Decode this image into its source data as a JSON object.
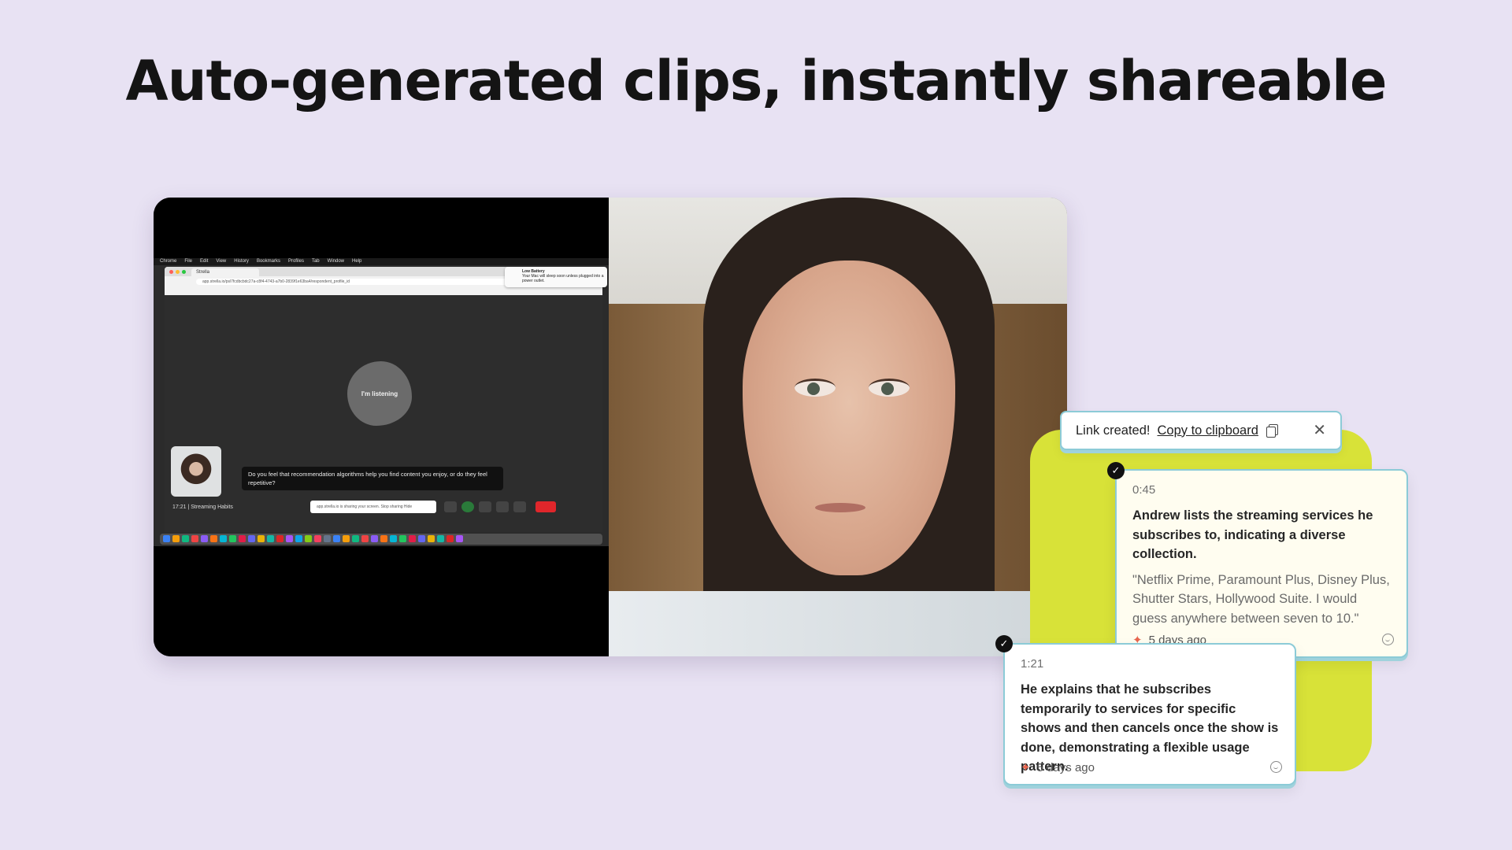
{
  "headline": "Auto-generated clips, instantly shareable",
  "mini_screen": {
    "menubar": [
      "Chrome",
      "File",
      "Edit",
      "View",
      "History",
      "Bookmarks",
      "Profiles",
      "Tab",
      "Window",
      "Help"
    ],
    "tab_title": "Strella",
    "url": "app.strella.io/psl7fcdbcbdc27a-c8f4-4743-a7b0-2839f1e63ba4/respondent_profile_id",
    "battery_title": "Low Battery",
    "battery_text": "Your Mac will sleep soon unless plugged into a power outlet.",
    "blob_label": "I'm listening",
    "question": "Do you feel that recommendation algorithms help you find content you enjoy, or do they feel repetitive?",
    "footer_label": "17:21  | Streaming Habits",
    "share_text": "app.strella.io is sharing your screen.",
    "stop_sharing": "Stop sharing",
    "hide": "Hide"
  },
  "toast": {
    "message": "Link created!",
    "link": "Copy to clipboard"
  },
  "clips": [
    {
      "time": "0:45",
      "summary": "Andrew lists the streaming services he subscribes to, indicating a diverse collection.",
      "quote": "\"Netflix Prime, Paramount Plus, Disney Plus, Shutter Stars, Hollywood Suite. I would guess anywhere between seven to 10.\"",
      "age": "5 days ago"
    },
    {
      "time": "1:21",
      "summary": "He explains that he subscribes temporarily to services for specific shows and then cancels once the show is done, demonstrating a flexible usage pattern.",
      "age": "5 days ago"
    }
  ],
  "colors": {
    "background": "#e8e2f3",
    "accent_lime": "#d8e238",
    "card_border": "#8ccbd7",
    "sparkle": "#e8664f"
  }
}
